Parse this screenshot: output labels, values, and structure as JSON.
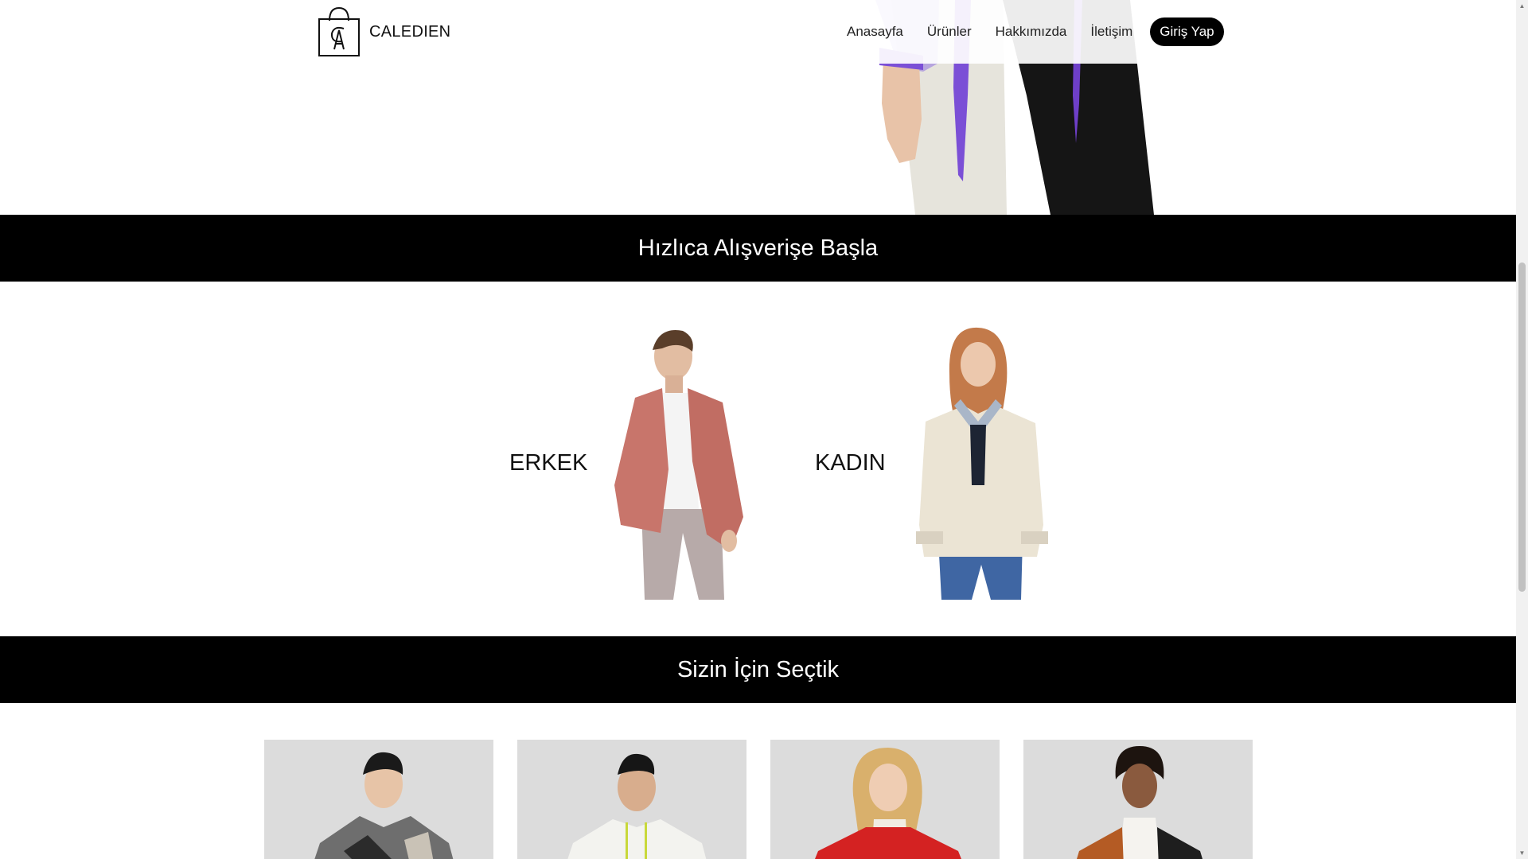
{
  "brand": {
    "name": "CALEDIEN"
  },
  "nav": {
    "items": [
      "Anasayfa",
      "Ürünler",
      "Hakkımızda",
      "İletişim"
    ],
    "login_label": "Giriş Yap"
  },
  "sections": {
    "quick_shop_title": "Hızlıca Alışverişe Başla",
    "picks_title": "Sizin İçin Seçtik"
  },
  "quick_shop": {
    "men_label": "ERKEK",
    "women_label": "KADIN"
  },
  "colors": {
    "banner_bg": "#000000",
    "accent_purple": "#7b4fd6"
  },
  "icons": {
    "logo": "shopping-bag-logo-icon",
    "scroll_up": "chevron-up-icon",
    "scroll_down": "chevron-down-icon"
  }
}
